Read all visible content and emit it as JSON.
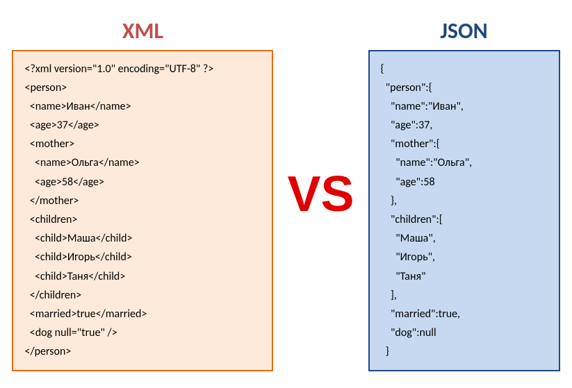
{
  "titles": {
    "xml": "XML",
    "json": "JSON",
    "vs": "VS"
  },
  "xml": {
    "l0": "<?xml version=\"1.0\" encoding=\"UTF-8\" ?>",
    "l1": "<person>",
    "l2": "  <name>Иван</name>",
    "l3": "  <age>37</age>",
    "l4": "  <mother>",
    "l5": "    <name>Ольга</name>",
    "l6": "    <age>58</age>",
    "l7": "  </mother>",
    "l8": "  <children>",
    "l9": "    <child>Маша</child>",
    "l10": "    <child>Игорь</child>",
    "l11": "    <child>Таня</child>",
    "l12": "  </children>",
    "l13": "  <married>true</married>",
    "l14": "  <dog null=\"true\" />",
    "l15": "</person>"
  },
  "json": {
    "l0": "{",
    "l1": "  \"person\":{",
    "l2": "    \"name\":\"Иван\",",
    "l3": "    \"age\":37,",
    "l4": "    \"mother\":{",
    "l5": "      \"name\":\"Ольга\",",
    "l6": "      \"age\":58",
    "l7": "    },",
    "l8": "    \"children\":[",
    "l9": "      \"Маша\",",
    "l10": "      \"Игорь\",",
    "l11": "      \"Таня\"",
    "l12": "    ],",
    "l13": "    \"married\":true,",
    "l14": "    \"dog\":null",
    "l15": "  }"
  }
}
